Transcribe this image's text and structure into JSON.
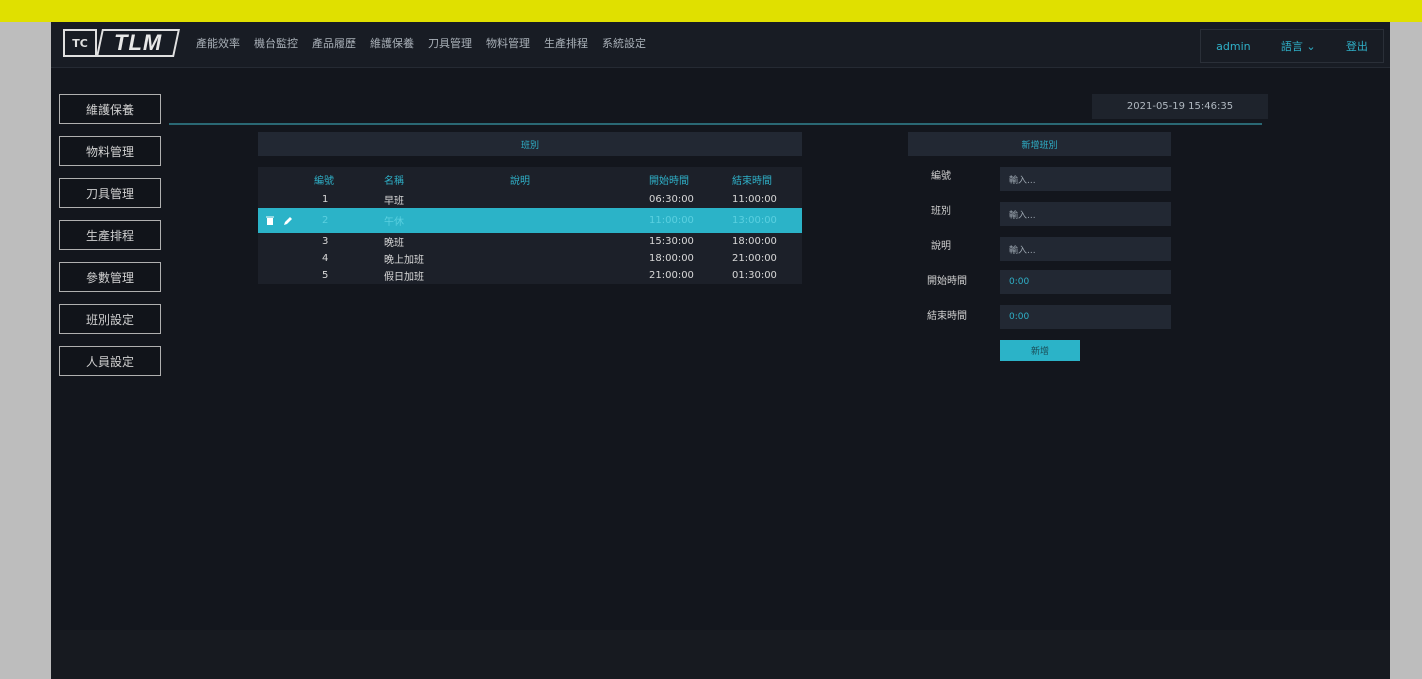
{
  "nav": {
    "logo_text": "TLM",
    "logo_badge": "TC",
    "menu": [
      "產能效率",
      "機台監控",
      "產品履歷",
      "維護保養",
      "刀具管理",
      "物料管理",
      "生產排程",
      "系統設定"
    ],
    "user": "admin",
    "language": "語言 ⌄",
    "logout": "登出"
  },
  "sidebar": {
    "items": [
      "維護保養",
      "物料管理",
      "刀具管理",
      "生產排程",
      "參數管理",
      "班別設定",
      "人員設定"
    ]
  },
  "datetime": "2021-05-19 15:46:35",
  "list": {
    "title": "班別",
    "columns": [
      "編號",
      "名稱",
      "說明",
      "開始時間",
      "結束時間"
    ],
    "rows": [
      {
        "id": "1",
        "name": "早班",
        "desc": "",
        "start": "06:30:00",
        "end": "11:00:00"
      },
      {
        "id": "2",
        "name": "午休",
        "desc": "",
        "start": "11:00:00",
        "end": "13:00:00"
      },
      {
        "id": "3",
        "name": "晚班",
        "desc": "",
        "start": "15:30:00",
        "end": "18:00:00"
      },
      {
        "id": "4",
        "name": "晚上加班",
        "desc": "",
        "start": "18:00:00",
        "end": "21:00:00"
      },
      {
        "id": "5",
        "name": "假日加班",
        "desc": "",
        "start": "21:00:00",
        "end": "01:30:00"
      }
    ],
    "selected_row": 1
  },
  "form": {
    "title": "新增班別",
    "fields": [
      {
        "label": "編號",
        "placeholder": "輸入..."
      },
      {
        "label": "班別",
        "placeholder": "輸入..."
      },
      {
        "label": "說明",
        "placeholder": "輸入..."
      },
      {
        "label": "開始時間",
        "placeholder": "0:00"
      },
      {
        "label": "結束時間",
        "placeholder": "0:00"
      }
    ],
    "submit": "新增"
  },
  "colors": {
    "accent": "#2bb3c8",
    "background": "#13161d",
    "outer_top": "#e0e000"
  }
}
